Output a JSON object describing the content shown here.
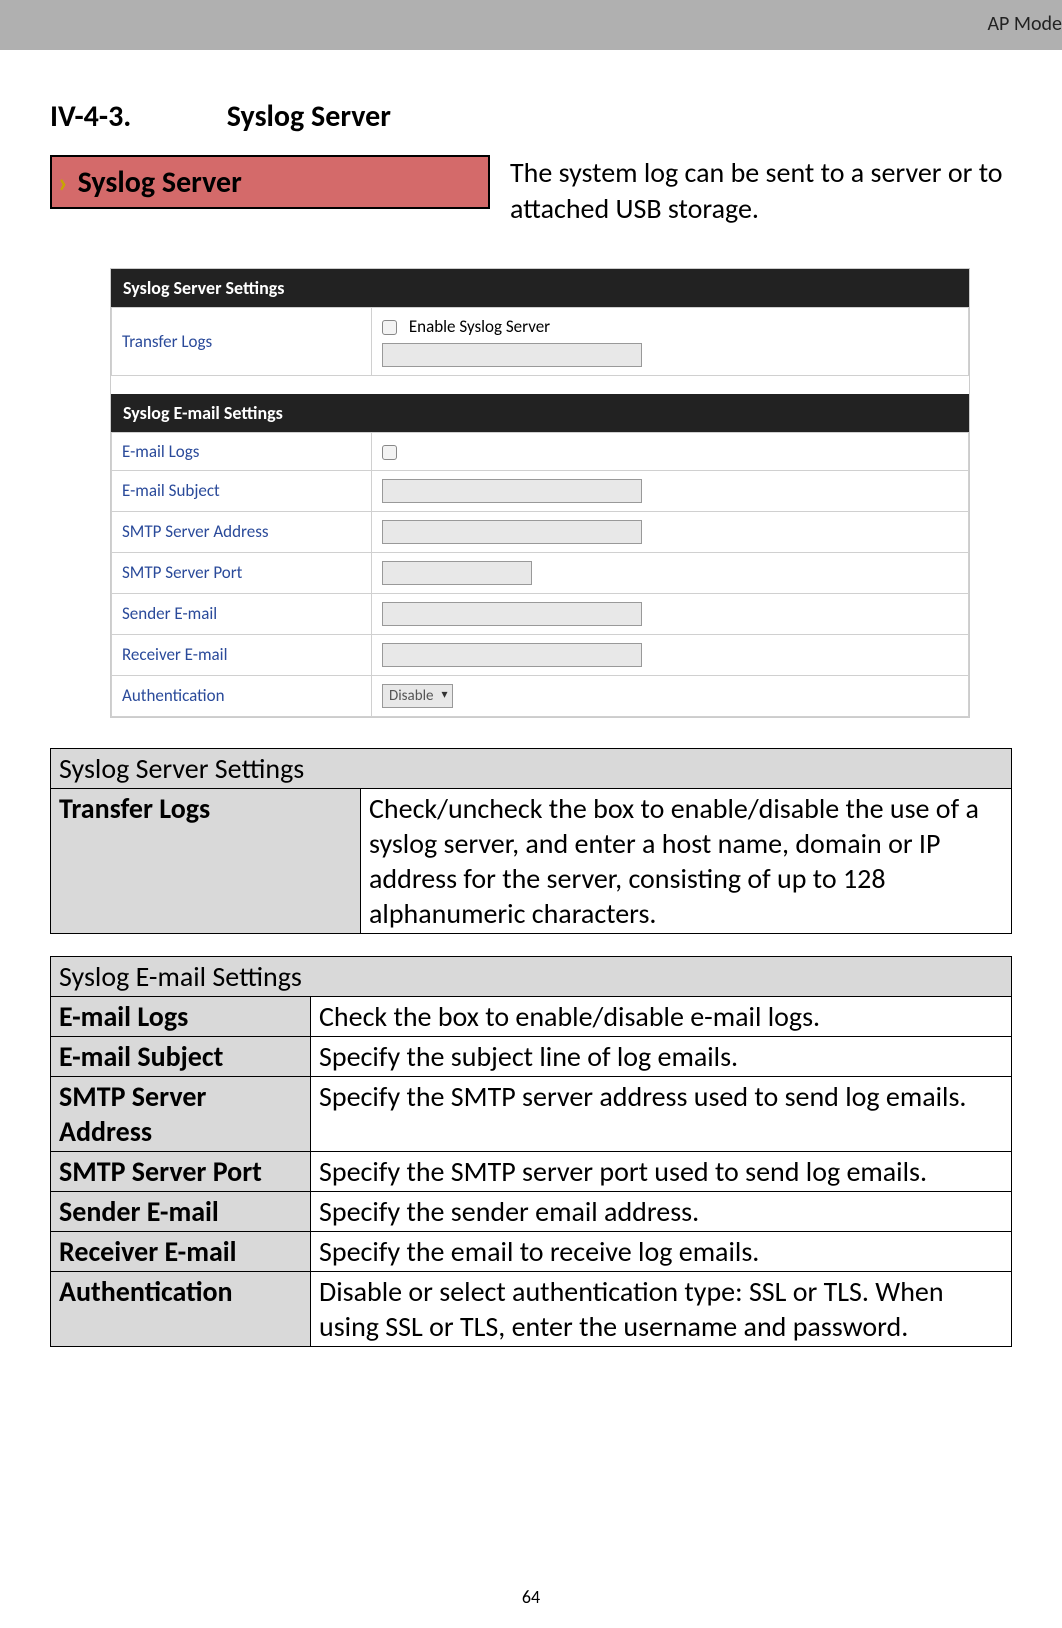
{
  "header": {
    "mode": "AP Mode"
  },
  "section": {
    "number": "IV-4-3.",
    "title": "Syslog Server"
  },
  "nav": {
    "label": "Syslog Server"
  },
  "intro": "The system log can be sent to a server or to attached USB storage.",
  "ui_panels": {
    "server": {
      "title": "Syslog Server Settings",
      "rows": {
        "transfer_label": "Transfer Logs",
        "enable_label": "Enable Syslog Server"
      }
    },
    "email": {
      "title": "Syslog E-mail Settings",
      "rows": {
        "logs": "E-mail Logs",
        "subject": "E-mail Subject",
        "smtp_addr": "SMTP Server Address",
        "smtp_port": "SMTP Server Port",
        "sender": "Sender E-mail",
        "receiver": "Receiver E-mail",
        "auth": "Authentication",
        "auth_value": "Disable"
      }
    }
  },
  "table1": {
    "header": "Syslog Server Settings",
    "rows": [
      {
        "k": "Transfer Logs",
        "v": "Check/uncheck the box to enable/disable the use of a syslog server, and enter a host name, domain or IP address for the server, consisting of up to 128 alphanumeric characters."
      }
    ]
  },
  "table2": {
    "header": "Syslog E-mail Settings",
    "rows": [
      {
        "k": "E-mail Logs",
        "v": "Check the box to enable/disable e-mail logs."
      },
      {
        "k": "E-mail Subject",
        "v": "Specify the subject line of log emails."
      },
      {
        "k": "SMTP Server Address",
        "v": "Specify the SMTP server address used to send log emails."
      },
      {
        "k": "SMTP Server Port",
        "v": "Specify the SMTP server port used to send log emails."
      },
      {
        "k": "Sender E-mail",
        "v": "Specify the sender email address."
      },
      {
        "k": "Receiver E-mail",
        "v": "Specify the email to receive log emails."
      },
      {
        "k": "Authentication",
        "v": "Disable or select authentication type: SSL or TLS. When using SSL or TLS, enter the username and password."
      }
    ]
  },
  "page_number": "64"
}
